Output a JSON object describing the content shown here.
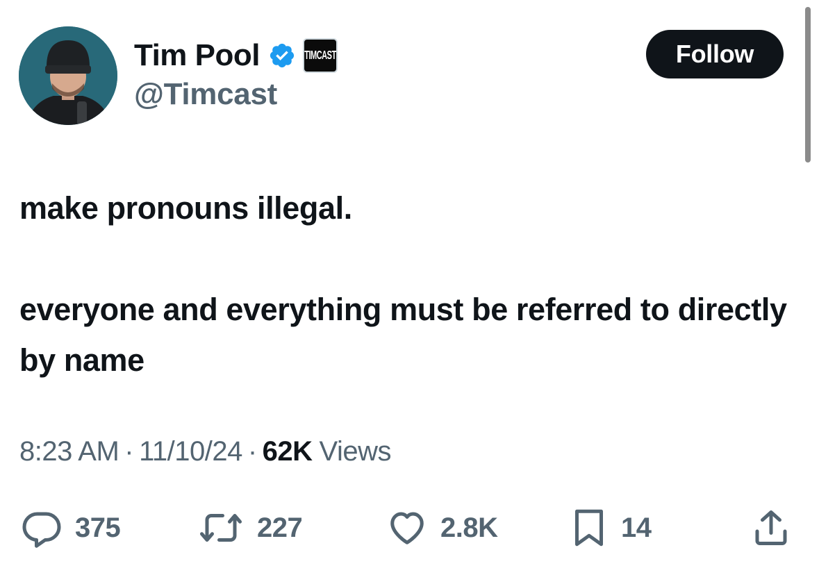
{
  "author": {
    "display_name": "Tim Pool",
    "handle": "@Timcast",
    "affiliate_badge_text": "TIMCAST",
    "verified_color": "#1d9bf0"
  },
  "follow_label": "Follow",
  "tweet": {
    "lines": [
      "make pronouns illegal.",
      "everyone and everything must be referred to directly by name"
    ]
  },
  "meta": {
    "time": "8:23 AM",
    "date": "11/10/24",
    "views_count": "62K",
    "views_label": "Views",
    "separator": "·"
  },
  "actions": {
    "replies": "375",
    "reposts": "227",
    "likes": "2.8K",
    "bookmarks": "14"
  },
  "icons": [
    "reply-icon",
    "repost-icon",
    "like-icon",
    "bookmark-icon",
    "share-icon",
    "verified-badge-icon"
  ]
}
